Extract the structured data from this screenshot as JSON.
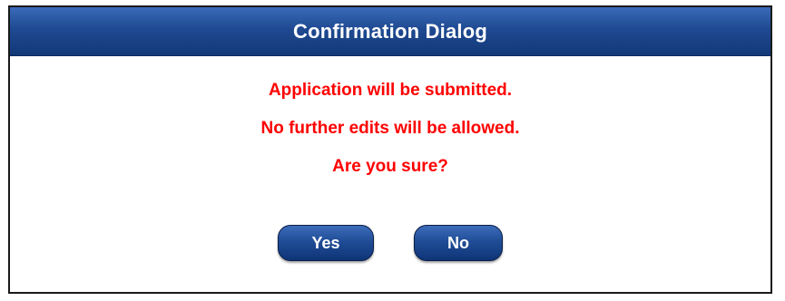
{
  "dialog": {
    "title": "Confirmation Dialog",
    "messages": [
      "Application will be submitted.",
      "No further edits will be allowed.",
      "Are you sure?"
    ],
    "yes_label": "Yes",
    "no_label": "No"
  },
  "colors": {
    "title_bar": "#1f4a92",
    "button": "#204d96",
    "message_text": "#ff0000",
    "title_text": "#ffffff"
  }
}
